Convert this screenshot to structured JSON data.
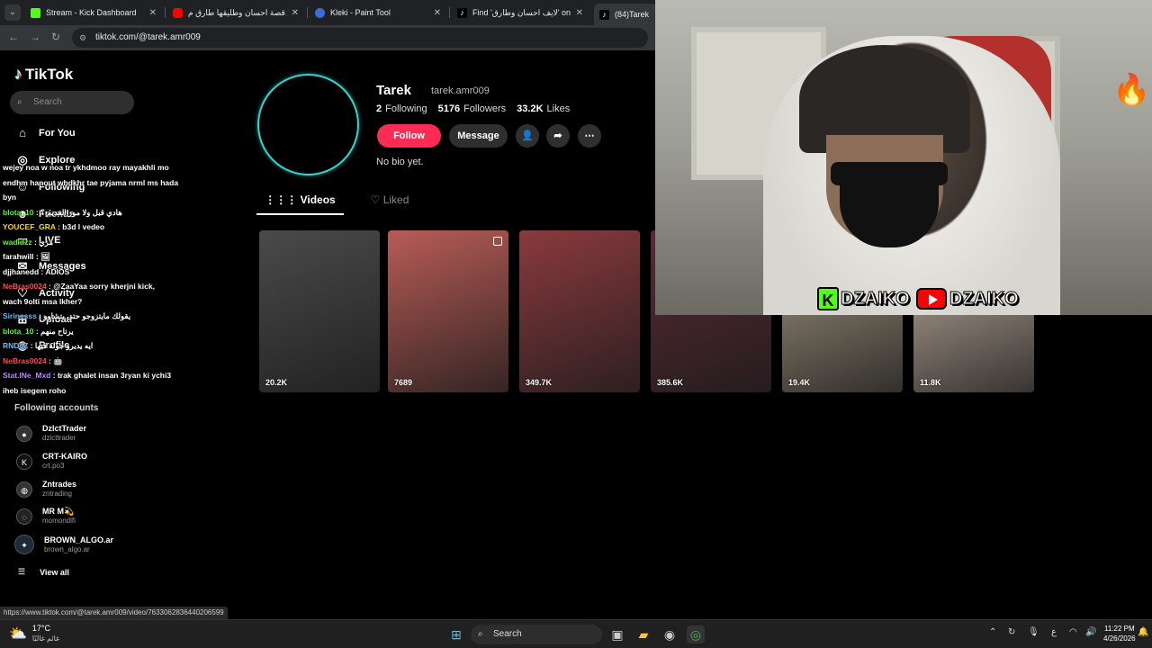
{
  "browser": {
    "tabs": [
      {
        "title": "Stream - Kick Dashboard",
        "color": "#53fc18"
      },
      {
        "title": "قصة احسان وطليقها طارق م... 🚆",
        "color": "#ff0000"
      },
      {
        "title": "Kleki - Paint Tool",
        "color": "#3d6bdb"
      },
      {
        "title": "Find 'لايف احسان وطارق' on TikT",
        "color": "#ffffff"
      },
      {
        "title": "(84)Tarek (@",
        "color": "#ffffff"
      }
    ],
    "url": "tiktok.com/@tarek.amr009",
    "status_url": "https://www.tiktok.com/@tarek.amr009/video/7633062836440206599"
  },
  "sidebar": {
    "logo": "TikTok",
    "search_placeholder": "Search",
    "nav": [
      {
        "label": "For You",
        "icon": "home-icon"
      },
      {
        "label": "Explore",
        "icon": "compass-icon"
      },
      {
        "label": "Following",
        "icon": "following-icon"
      },
      {
        "label": "Friends",
        "icon": "friends-icon"
      },
      {
        "label": "LIVE",
        "icon": "live-icon"
      },
      {
        "label": "Messages",
        "icon": "messages-icon"
      },
      {
        "label": "Activity",
        "icon": "activity-icon"
      },
      {
        "label": "Upload",
        "icon": "upload-icon"
      },
      {
        "label": "Profile",
        "icon": "profile-icon"
      }
    ],
    "following_title": "Following accounts",
    "accounts": [
      {
        "name": "DzIctTrader",
        "handle": "dzicttrader"
      },
      {
        "name": "CRT-KAIRO",
        "handle": "crt.po3"
      },
      {
        "name": "Zntrades",
        "handle": "zntrading"
      },
      {
        "name": "MR M💫",
        "handle": "momondlfi"
      },
      {
        "name": "BROWN_ALGO.ar",
        "handle": "brown_algo.ar"
      }
    ],
    "view_all": "View all"
  },
  "chat": [
    {
      "user": "",
      "text": "wejey noa w noa tr ykhdmoo ray mayakhli mo",
      "ucolor": "#ffffff"
    },
    {
      "user": "",
      "text": "endhm hanout whdkhr tae pyjama nrml ms hada",
      "ucolor": "#ffffff"
    },
    {
      "user": "",
      "text": "byn",
      "ucolor": "#ffffff"
    },
    {
      "user": "blota_10",
      "text": "هادي قبل ولا مور القديم ؟",
      "ucolor": "#53fc18"
    },
    {
      "user": "YOUCEF_GRA",
      "text": "b3d l vedeo",
      "ucolor": "#ffd700"
    },
    {
      "user": "wadidzz",
      "text": "مزي",
      "ucolor": "#53fc18"
    },
    {
      "user": "farahwill",
      "text": "🖼",
      "ucolor": "#ffffff"
    },
    {
      "user": "djjhanedd",
      "text": "ADIOS",
      "ucolor": "#ffffff"
    },
    {
      "user": "NeBras0024",
      "text": "@ZaaYaa sorry kherjni kick,",
      "ucolor": "#ff4d4d"
    },
    {
      "user": "",
      "text": "wach 9olti msa lkher?",
      "ucolor": "#ffffff"
    },
    {
      "user": "Sirinesss",
      "text": "يقولك مايتزوجو حتى يتشاوو",
      "ucolor": "#6ab8ff"
    },
    {
      "user": "blota_10",
      "text": "يرتاح منهم",
      "ucolor": "#53fc18"
    },
    {
      "user": "RNDeZ",
      "text": "ايه يديرو جولة فيها",
      "ucolor": "#6ab8ff"
    },
    {
      "user": "NeBras0024",
      "text": "🤖",
      "ucolor": "#ff4d4d"
    },
    {
      "user": "Stat.INe_Mxd",
      "text": "trak ghalet insan 3ryan ki ychi3",
      "ucolor": "#b388ff"
    },
    {
      "user": "",
      "text": "iheb isegem roho",
      "ucolor": "#ffffff"
    }
  ],
  "profile": {
    "name": "Tarek",
    "handle": "tarek.amr009",
    "following_count": "2",
    "following_label": "Following",
    "followers_count": "5176",
    "followers_label": "Followers",
    "likes_count": "33.2K",
    "likes_label": "Likes",
    "follow_label": "Follow",
    "message_label": "Message",
    "bio": "No bio yet.",
    "tab_videos": "Videos",
    "tab_liked": "Liked"
  },
  "videos": [
    {
      "views": "20.2K",
      "bg": "#4a4a4a",
      "pinned": false
    },
    {
      "views": "7689",
      "bg": "#b85c56",
      "pinned": true
    },
    {
      "views": "349.7K",
      "bg": "#8a3a3e",
      "pinned": false
    },
    {
      "views": "385.6K",
      "bg": "#5a2a36",
      "pinned": false
    },
    {
      "views": "19.4K",
      "bg": "#a89a84",
      "pinned": false
    },
    {
      "views": "11.8K",
      "bg": "#c8b6a6",
      "pinned": false
    }
  ],
  "stream_overlay": {
    "kick_name": "DZAIKO",
    "youtube_name": "DZAIKO"
  },
  "taskbar": {
    "temperature": "17°C",
    "weather_text": "غائم غالبًا",
    "search_label": "Search",
    "lang": "ع",
    "time": "11:22 PM",
    "date": "4/26/2026"
  }
}
